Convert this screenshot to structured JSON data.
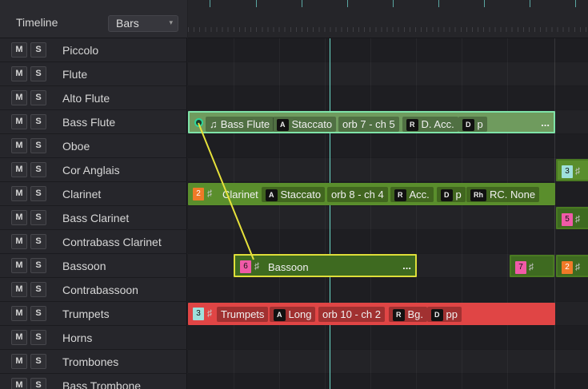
{
  "header": {
    "title": "Timeline",
    "view_value": "Bars",
    "view_caret": "▾"
  },
  "colors": {
    "playhead": "#6bd9c8",
    "green_clip": "#5a8e2c",
    "selected_clip": "#6f9b5e",
    "red_clip": "#e04545",
    "link": "#e7e23b"
  },
  "tracks": [
    {
      "mute": "M",
      "solo": "S",
      "name": "Piccolo"
    },
    {
      "mute": "M",
      "solo": "S",
      "name": "Flute"
    },
    {
      "mute": "M",
      "solo": "S",
      "name": "Alto Flute"
    },
    {
      "mute": "M",
      "solo": "S",
      "name": "Bass Flute"
    },
    {
      "mute": "M",
      "solo": "S",
      "name": "Oboe"
    },
    {
      "mute": "M",
      "solo": "S",
      "name": "Cor Anglais"
    },
    {
      "mute": "M",
      "solo": "S",
      "name": "Clarinet"
    },
    {
      "mute": "M",
      "solo": "S",
      "name": "Bass Clarinet"
    },
    {
      "mute": "M",
      "solo": "S",
      "name": "Contrabass Clarinet"
    },
    {
      "mute": "M",
      "solo": "S",
      "name": "Bassoon"
    },
    {
      "mute": "M",
      "solo": "S",
      "name": "Contrabassoon"
    },
    {
      "mute": "M",
      "solo": "S",
      "name": "Trumpets"
    },
    {
      "mute": "M",
      "solo": "S",
      "name": "Horns"
    },
    {
      "mute": "M",
      "solo": "S",
      "name": "Trombones"
    },
    {
      "mute": "M",
      "solo": "S",
      "name": "Bass Trombone"
    }
  ],
  "clips": {
    "bass_flute": {
      "name": "Bass Flute",
      "articulation_key": "A",
      "articulation": "Staccato",
      "channel": "orb 7 - ch 5",
      "reverb_key": "R",
      "reverb": "D. Acc.",
      "dynamic_key": "D",
      "dynamic": "p",
      "more": "..."
    },
    "clarinet": {
      "number": "2",
      "name": "Clarinet",
      "articulation_key": "A",
      "articulation": "Staccato",
      "channel": "orb 8 - ch 4",
      "reverb_key": "R",
      "reverb": "Acc.",
      "dynamic_key": "D",
      "dynamic": "p",
      "rh_key": "Rh",
      "rh": "RC. None"
    },
    "cor_anglais_edge": {
      "number": "3"
    },
    "bass_clarinet_edge": {
      "number": "5"
    },
    "bassoon": {
      "number": "6",
      "name": "Bassoon",
      "more": "..."
    },
    "bassoon_2": {
      "number": "7"
    },
    "bassoon_3": {
      "number": "2"
    },
    "trumpets": {
      "number": "3",
      "name": "Trumpets",
      "articulation_key": "A",
      "articulation": "Long",
      "channel": "orb 10 - ch 2",
      "reverb_key": "R",
      "reverb": "Bg.",
      "dynamic_key": "D",
      "dynamic": "pp"
    }
  }
}
